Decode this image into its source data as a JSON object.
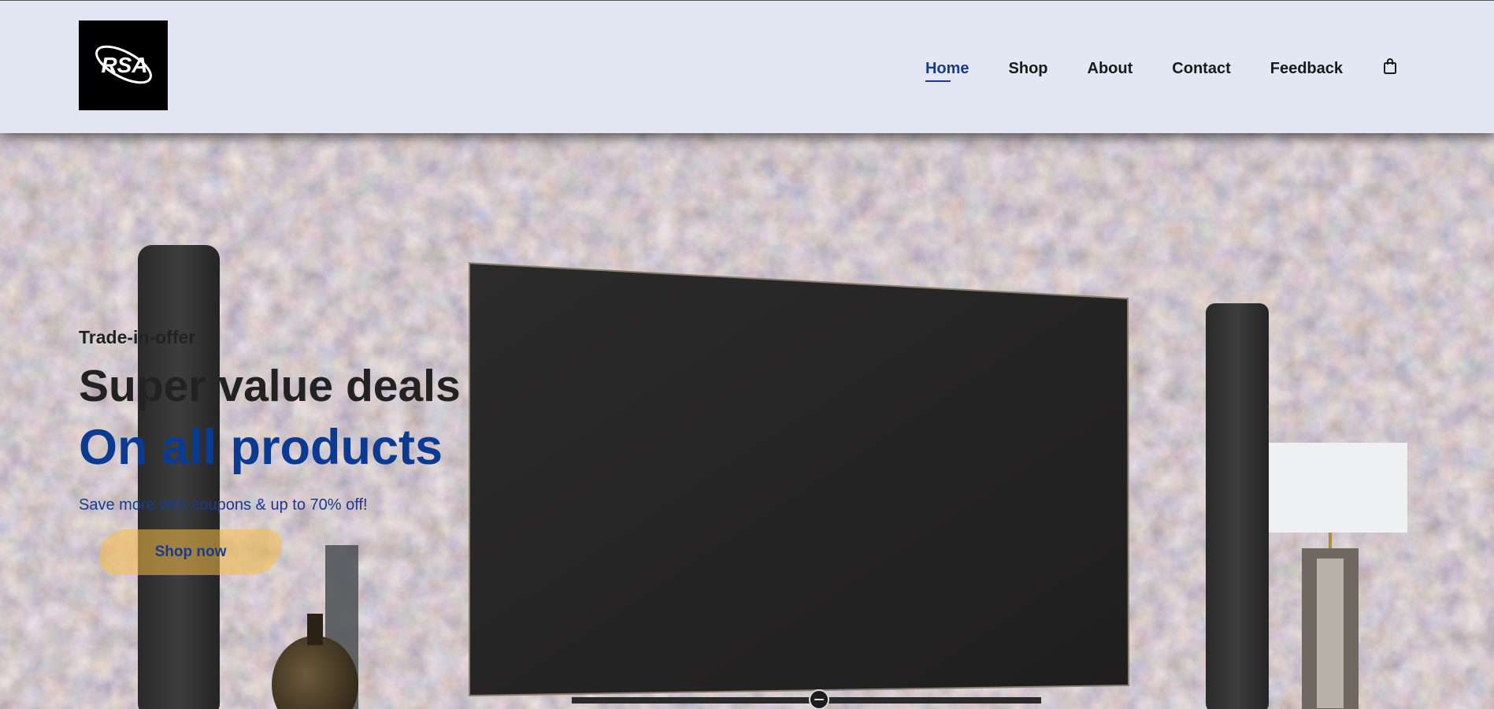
{
  "brand": {
    "logo_text": "RSA"
  },
  "nav": {
    "items": [
      {
        "label": "Home",
        "active": true
      },
      {
        "label": "Shop",
        "active": false
      },
      {
        "label": "About",
        "active": false
      },
      {
        "label": "Contact",
        "active": false
      },
      {
        "label": "Feedback",
        "active": false
      }
    ],
    "cart_icon": "shopping-bag-icon"
  },
  "hero": {
    "kicker": "Trade-in-offer",
    "headline": "Super value deals",
    "headline_accent": "On all products",
    "subtext": "Save more with coupons & up to 70% off!",
    "cta_label": "Shop now",
    "background": "living-room-tv-stone-wall-photo"
  },
  "colors": {
    "header_bg": "#e3e6f3",
    "accent_blue": "#0b3a93",
    "cta_yellow": "#f8be46",
    "text_dark": "#222222"
  }
}
